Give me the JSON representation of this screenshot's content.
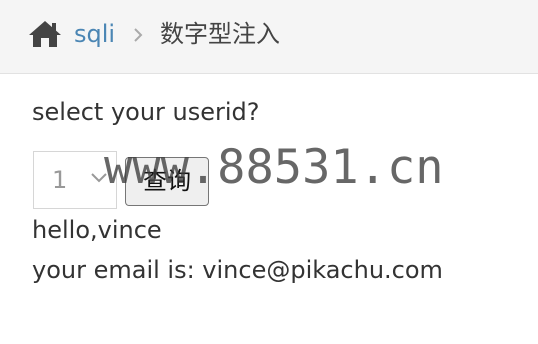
{
  "breadcrumb": {
    "home_icon": "home-icon",
    "link_label": "sqli",
    "separator_icon": "chevron-right-icon",
    "current_label": "数字型注入"
  },
  "form": {
    "prompt": "select your userid?",
    "select": {
      "selected_value": "1",
      "chevron_icon": "chevron-down-icon"
    },
    "submit_label": "查询"
  },
  "result": {
    "greeting": "hello,vince",
    "email_line": "your email is: vince@pikachu.com"
  },
  "watermark": "www.88531.cn",
  "colors": {
    "link": "#4b86b4",
    "breadcrumb_bg": "#f5f5f5",
    "text": "#333333"
  }
}
